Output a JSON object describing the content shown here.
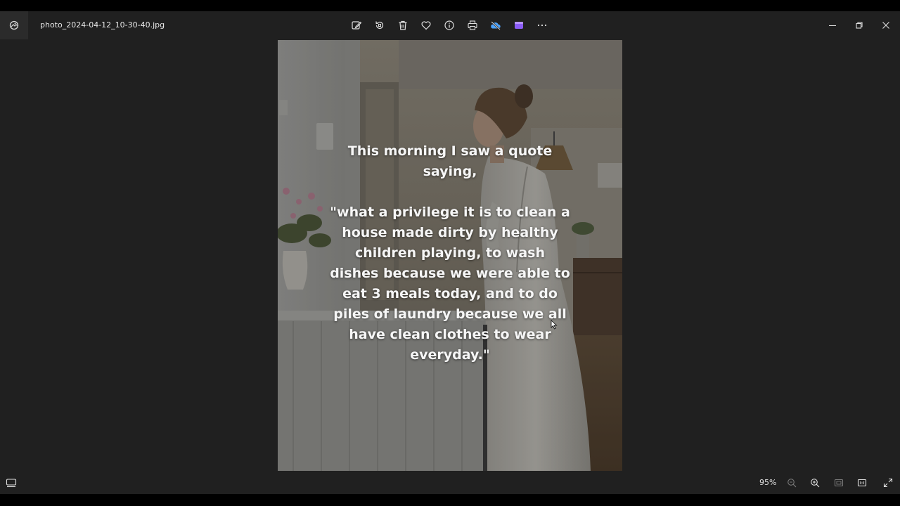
{
  "window": {
    "filename": "photo_2024-04-12_10-30-40.jpg"
  },
  "toolbar": {
    "items": [
      {
        "name": "edit-image-icon"
      },
      {
        "name": "rotate-icon"
      },
      {
        "name": "delete-icon"
      },
      {
        "name": "favorite-heart-icon"
      },
      {
        "name": "info-icon"
      },
      {
        "name": "print-icon"
      },
      {
        "name": "onedrive-cloud-icon"
      },
      {
        "name": "clipchamp-icon"
      },
      {
        "name": "more-options-icon"
      }
    ]
  },
  "photo": {
    "quote_lines": [
      "This morning I saw a quote",
      "saying,",
      "\"what a privilege it is to clean a",
      "house made dirty by healthy",
      "children playing, to wash",
      "dishes because we were able to",
      "eat 3 meals today, and to do",
      "piles of laundry because we all",
      "have clean clothes to wear",
      "everyday.\""
    ]
  },
  "statusbar": {
    "zoom": "95%"
  },
  "colors": {
    "background": "#202020",
    "accent_onedrive": "#4da3ff",
    "accent_clipchamp": "#8a5cf6"
  }
}
